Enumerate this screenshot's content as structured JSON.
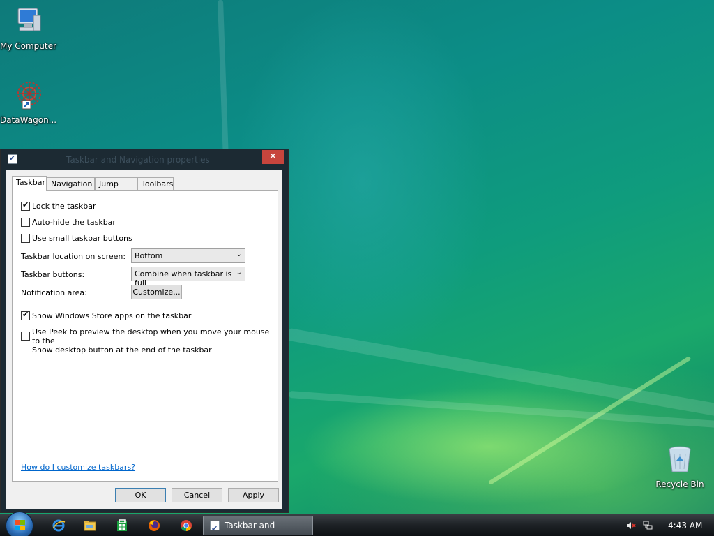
{
  "desktop": {
    "icons": [
      {
        "label": "My Computer",
        "icon": "computer-icon"
      },
      {
        "label": "DataWagon...",
        "icon": "datawagon-shortcut-icon"
      },
      {
        "label": "Recycle Bin",
        "icon": "recycle-bin-icon"
      }
    ]
  },
  "dialog": {
    "title": "Taskbar and Navigation properties",
    "close_label": "✕",
    "tabs": [
      {
        "label": "Taskbar",
        "active": true
      },
      {
        "label": "Navigation",
        "active": false
      },
      {
        "label": "Jump Lists",
        "active": false
      },
      {
        "label": "Toolbars",
        "active": false
      }
    ],
    "checkboxes": {
      "lock": {
        "label": "Lock the taskbar",
        "checked": true
      },
      "autohide": {
        "label": "Auto-hide the taskbar",
        "checked": false
      },
      "small": {
        "label": "Use small taskbar buttons",
        "checked": false
      },
      "store_apps": {
        "label": "Show Windows Store apps on the taskbar",
        "checked": true
      },
      "peek": {
        "label_line1": "Use Peek to preview the desktop when you move your mouse to the",
        "label_line2": "Show desktop button at the end of the taskbar",
        "checked": false
      }
    },
    "location": {
      "label": "Taskbar location on screen:",
      "value": "Bottom"
    },
    "buttons_mode": {
      "label": "Taskbar buttons:",
      "value": "Combine when taskbar is full"
    },
    "notification": {
      "label": "Notification area:",
      "button": "Customize..."
    },
    "help_link": "How do I customize taskbars?",
    "footer": {
      "ok": "OK",
      "cancel": "Cancel",
      "apply": "Apply"
    }
  },
  "taskbar": {
    "pinned": [
      "internet-explorer-icon",
      "file-explorer-icon",
      "store-icon",
      "firefox-icon",
      "chrome-icon"
    ],
    "task_label": "Taskbar and Navigati...",
    "clock": "4:43 AM"
  }
}
